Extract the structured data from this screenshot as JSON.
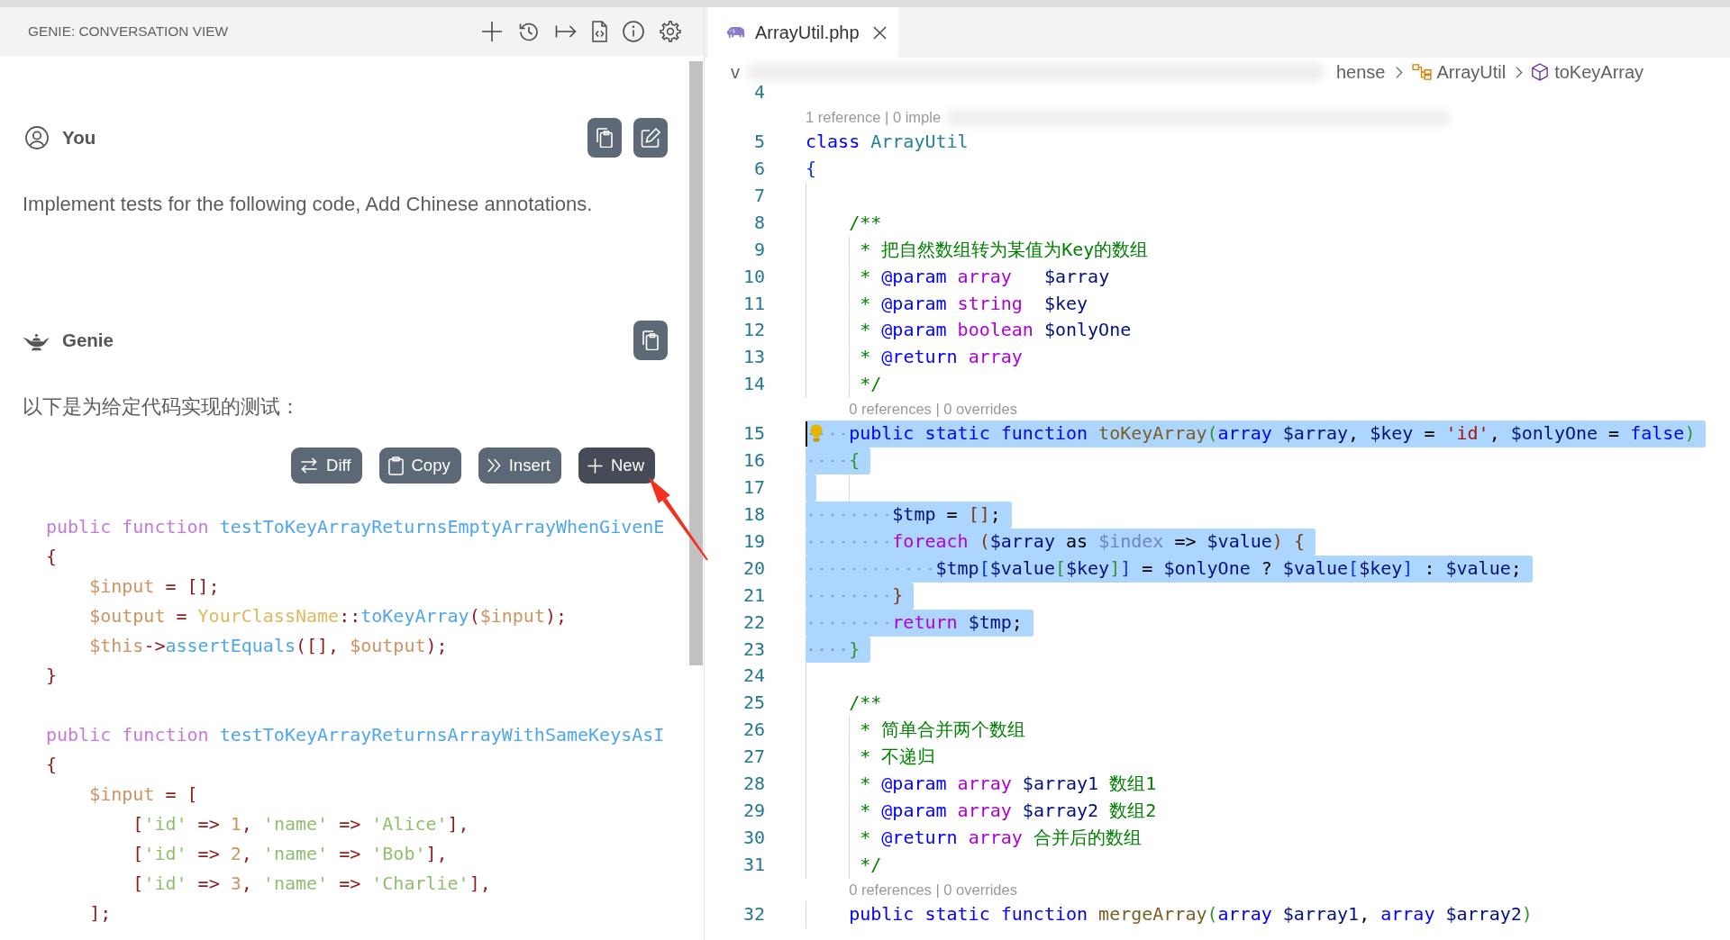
{
  "chat": {
    "title": "GENIE: CONVERSATION VIEW",
    "messages": [
      {
        "kind": "user",
        "author": "You",
        "text": "Implement tests for the following code, Add Chinese annotations."
      },
      {
        "kind": "assistant",
        "author": "Genie",
        "text": "以下是为给定代码实现的测试：",
        "code_actions": [
          {
            "label": "Diff",
            "kind": "diff",
            "hovered": false
          },
          {
            "label": "Copy",
            "kind": "copy",
            "hovered": false
          },
          {
            "label": "Insert",
            "kind": "insert",
            "hovered": false
          },
          {
            "label": "New",
            "kind": "new",
            "hovered": true
          }
        ],
        "code_lines": [
          {
            "kind": "code",
            "tokens": [
              {
                "text": "public function ",
                "kind": "keyword"
              },
              {
                "text": "testToKeyArrayReturnsEmptyArrayWhenGivenE",
                "kind": "function"
              }
            ]
          },
          {
            "kind": "code",
            "tokens": [
              {
                "text": "{",
                "kind": "punct"
              }
            ]
          },
          {
            "kind": "code",
            "tokens": [
              {
                "text": "    $input",
                "kind": "variable"
              },
              {
                "text": " = [];",
                "kind": "punct"
              }
            ]
          },
          {
            "kind": "code",
            "tokens": [
              {
                "text": "    $output",
                "kind": "variable"
              },
              {
                "text": " = ",
                "kind": "punct"
              },
              {
                "text": "YourClassName",
                "kind": "class"
              },
              {
                "text": "::",
                "kind": "punct"
              },
              {
                "text": "toKeyArray",
                "kind": "function"
              },
              {
                "text": "(",
                "kind": "punct"
              },
              {
                "text": "$input",
                "kind": "variable"
              },
              {
                "text": ");",
                "kind": "punct"
              }
            ]
          },
          {
            "kind": "code",
            "tokens": [
              {
                "text": "    $this",
                "kind": "variable"
              },
              {
                "text": "->",
                "kind": "punct"
              },
              {
                "text": "assertEquals",
                "kind": "function"
              },
              {
                "text": "([], ",
                "kind": "punct"
              },
              {
                "text": "$output",
                "kind": "variable"
              },
              {
                "text": ");",
                "kind": "punct"
              }
            ]
          },
          {
            "kind": "code",
            "tokens": [
              {
                "text": "}",
                "kind": "punct"
              }
            ]
          },
          {
            "kind": "blank"
          },
          {
            "kind": "code",
            "tokens": [
              {
                "text": "public function ",
                "kind": "keyword"
              },
              {
                "text": "testToKeyArrayReturnsArrayWithSameKeysAsI",
                "kind": "function"
              }
            ]
          },
          {
            "kind": "code",
            "tokens": [
              {
                "text": "{",
                "kind": "punct"
              }
            ]
          },
          {
            "kind": "code",
            "tokens": [
              {
                "text": "    $input",
                "kind": "variable"
              },
              {
                "text": " = [",
                "kind": "punct"
              }
            ]
          },
          {
            "kind": "code",
            "tokens": [
              {
                "text": "        [",
                "kind": "punct"
              },
              {
                "text": "'id'",
                "kind": "string"
              },
              {
                "text": " => ",
                "kind": "punct"
              },
              {
                "text": "1",
                "kind": "number"
              },
              {
                "text": ", ",
                "kind": "punct"
              },
              {
                "text": "'name'",
                "kind": "string"
              },
              {
                "text": " => ",
                "kind": "punct"
              },
              {
                "text": "'Alice'",
                "kind": "string"
              },
              {
                "text": "],",
                "kind": "punct"
              }
            ]
          },
          {
            "kind": "code",
            "tokens": [
              {
                "text": "        [",
                "kind": "punct"
              },
              {
                "text": "'id'",
                "kind": "string"
              },
              {
                "text": " => ",
                "kind": "punct"
              },
              {
                "text": "2",
                "kind": "number"
              },
              {
                "text": ", ",
                "kind": "punct"
              },
              {
                "text": "'name'",
                "kind": "string"
              },
              {
                "text": " => ",
                "kind": "punct"
              },
              {
                "text": "'Bob'",
                "kind": "string"
              },
              {
                "text": "],",
                "kind": "punct"
              }
            ]
          },
          {
            "kind": "code",
            "tokens": [
              {
                "text": "        [",
                "kind": "punct"
              },
              {
                "text": "'id'",
                "kind": "string"
              },
              {
                "text": " => ",
                "kind": "punct"
              },
              {
                "text": "3",
                "kind": "number"
              },
              {
                "text": ", ",
                "kind": "punct"
              },
              {
                "text": "'name'",
                "kind": "string"
              },
              {
                "text": " => ",
                "kind": "punct"
              },
              {
                "text": "'Charlie'",
                "kind": "string"
              },
              {
                "text": "],",
                "kind": "punct"
              }
            ]
          },
          {
            "kind": "code",
            "tokens": [
              {
                "text": "    ];",
                "kind": "punct"
              }
            ]
          }
        ]
      }
    ]
  },
  "editor": {
    "tabs": [
      {
        "label": "ArrayUtil.php",
        "selected": true
      }
    ],
    "breadcrumbs": [
      {
        "label": "v",
        "kind": "folder",
        "blurred_before": false
      },
      {
        "label": "hense",
        "kind": "folder",
        "blurred_before": true
      },
      {
        "label": "ArrayUtil",
        "kind": "class",
        "blurred_before": false
      },
      {
        "label": "toKeyArray",
        "kind": "method",
        "blurred_before": false
      }
    ],
    "lines": [
      {
        "kind": "code",
        "number": "4",
        "selected": false,
        "cursor": false,
        "lightbulb": false
      },
      {
        "kind": "codelens",
        "text": "1 reference | 0 imple",
        "blurred_after": true
      },
      {
        "kind": "code",
        "number": "5",
        "selected": false,
        "cursor": false,
        "lightbulb": false,
        "tokens": [
          {
            "text": "class ",
            "kind": "keyword"
          },
          {
            "text": "ArrayUtil",
            "kind": "class"
          }
        ]
      },
      {
        "kind": "code",
        "number": "6",
        "selected": false,
        "cursor": false,
        "lightbulb": false,
        "tokens": [
          {
            "text": "{",
            "kind": "bracket1"
          }
        ]
      },
      {
        "kind": "code",
        "number": "7",
        "selected": false,
        "cursor": false,
        "lightbulb": false
      },
      {
        "kind": "code",
        "number": "8",
        "selected": false,
        "cursor": false,
        "lightbulb": false,
        "tokens": [
          {
            "text": "    /**",
            "kind": "comment"
          }
        ]
      },
      {
        "kind": "code",
        "number": "9",
        "selected": false,
        "cursor": false,
        "lightbulb": false,
        "tokens": [
          {
            "text": "     * 把自然数组转为某值为Key的数组",
            "kind": "comment"
          }
        ]
      },
      {
        "kind": "code",
        "number": "10",
        "selected": false,
        "cursor": false,
        "lightbulb": false,
        "tokens": [
          {
            "text": "     * ",
            "kind": "comment"
          },
          {
            "text": "@param",
            "kind": "doc_tag"
          },
          {
            "text": " array",
            "kind": "doc_type"
          },
          {
            "text": "   $array",
            "kind": "variable"
          }
        ]
      },
      {
        "kind": "code",
        "number": "11",
        "selected": false,
        "cursor": false,
        "lightbulb": false,
        "tokens": [
          {
            "text": "     * ",
            "kind": "comment"
          },
          {
            "text": "@param",
            "kind": "doc_tag"
          },
          {
            "text": " string",
            "kind": "doc_type"
          },
          {
            "text": "  $key",
            "kind": "variable"
          }
        ]
      },
      {
        "kind": "code",
        "number": "12",
        "selected": false,
        "cursor": false,
        "lightbulb": false,
        "tokens": [
          {
            "text": "     * ",
            "kind": "comment"
          },
          {
            "text": "@param",
            "kind": "doc_tag"
          },
          {
            "text": " boolean",
            "kind": "doc_type"
          },
          {
            "text": " $onlyOne",
            "kind": "variable"
          }
        ]
      },
      {
        "kind": "code",
        "number": "13",
        "selected": false,
        "cursor": false,
        "lightbulb": false,
        "tokens": [
          {
            "text": "     * ",
            "kind": "comment"
          },
          {
            "text": "@return",
            "kind": "doc_tag"
          },
          {
            "text": " array",
            "kind": "doc_type"
          }
        ]
      },
      {
        "kind": "code",
        "number": "14",
        "selected": false,
        "cursor": false,
        "lightbulb": false,
        "tokens": [
          {
            "text": "     */",
            "kind": "comment"
          }
        ]
      },
      {
        "kind": "codelens",
        "text": "0 references | 0 overrides",
        "blurred_after": false
      },
      {
        "kind": "code",
        "number": "15",
        "selected": true,
        "cursor": true,
        "lightbulb": true,
        "tokens": [
          {
            "text": "    public static function ",
            "kind": "keyword"
          },
          {
            "text": "toKeyArray",
            "kind": "function"
          },
          {
            "text": "(",
            "kind": "bracket2"
          },
          {
            "text": "array ",
            "kind": "keyword"
          },
          {
            "text": "$array",
            "kind": "variable"
          },
          {
            "text": ", ",
            "kind": "plain"
          },
          {
            "text": "$key",
            "kind": "variable"
          },
          {
            "text": " = ",
            "kind": "plain"
          },
          {
            "text": "'id'",
            "kind": "string"
          },
          {
            "text": ", ",
            "kind": "plain"
          },
          {
            "text": "$onlyOne",
            "kind": "variable"
          },
          {
            "text": " = ",
            "kind": "plain"
          },
          {
            "text": "false",
            "kind": "keyword"
          },
          {
            "text": ")",
            "kind": "bracket2"
          }
        ]
      },
      {
        "kind": "code",
        "number": "16",
        "selected": true,
        "cursor": false,
        "lightbulb": false,
        "tokens": [
          {
            "text": "    {",
            "kind": "bracket2"
          }
        ]
      },
      {
        "kind": "code",
        "number": "17",
        "selected": true,
        "cursor": false,
        "lightbulb": false
      },
      {
        "kind": "code",
        "number": "18",
        "selected": true,
        "cursor": false,
        "lightbulb": false,
        "tokens": [
          {
            "text": "        $tmp",
            "kind": "variable"
          },
          {
            "text": " = ",
            "kind": "plain"
          },
          {
            "text": "[]",
            "kind": "bracket3"
          },
          {
            "text": ";",
            "kind": "plain"
          }
        ]
      },
      {
        "kind": "code",
        "number": "19",
        "selected": true,
        "cursor": false,
        "lightbulb": false,
        "tokens": [
          {
            "text": "        foreach ",
            "kind": "control"
          },
          {
            "text": "(",
            "kind": "bracket3"
          },
          {
            "text": "$array ",
            "kind": "variable"
          },
          {
            "text": "as ",
            "kind": "plain"
          },
          {
            "text": "$index ",
            "kind": "unused"
          },
          {
            "text": "=> ",
            "kind": "plain"
          },
          {
            "text": "$value",
            "kind": "variable"
          },
          {
            "text": ") {",
            "kind": "bracket3"
          }
        ]
      },
      {
        "kind": "code",
        "number": "20",
        "selected": true,
        "cursor": false,
        "lightbulb": false,
        "tokens": [
          {
            "text": "            $tmp",
            "kind": "variable"
          },
          {
            "text": "[",
            "kind": "bracket1"
          },
          {
            "text": "$value",
            "kind": "variable"
          },
          {
            "text": "[",
            "kind": "bracket2"
          },
          {
            "text": "$key",
            "kind": "variable"
          },
          {
            "text": "]",
            "kind": "bracket2"
          },
          {
            "text": "]",
            "kind": "bracket1"
          },
          {
            "text": " = ",
            "kind": "plain"
          },
          {
            "text": "$onlyOne",
            "kind": "variable"
          },
          {
            "text": " ? ",
            "kind": "plain"
          },
          {
            "text": "$value",
            "kind": "variable"
          },
          {
            "text": "[",
            "kind": "bracket1"
          },
          {
            "text": "$key",
            "kind": "variable"
          },
          {
            "text": "]",
            "kind": "bracket1"
          },
          {
            "text": " : ",
            "kind": "plain"
          },
          {
            "text": "$value",
            "kind": "variable"
          },
          {
            "text": ";",
            "kind": "plain"
          }
        ]
      },
      {
        "kind": "code",
        "number": "21",
        "selected": true,
        "cursor": false,
        "lightbulb": false,
        "tokens": [
          {
            "text": "        }",
            "kind": "bracket3"
          }
        ]
      },
      {
        "kind": "code",
        "number": "22",
        "selected": true,
        "cursor": false,
        "lightbulb": false,
        "tokens": [
          {
            "text": "        return ",
            "kind": "control"
          },
          {
            "text": "$tmp",
            "kind": "variable"
          },
          {
            "text": ";",
            "kind": "plain"
          }
        ]
      },
      {
        "kind": "code",
        "number": "23",
        "selected": true,
        "cursor": false,
        "lightbulb": false,
        "tokens": [
          {
            "text": "    }",
            "kind": "bracket2"
          }
        ]
      },
      {
        "kind": "code",
        "number": "24",
        "selected": false,
        "cursor": false,
        "lightbulb": false
      },
      {
        "kind": "code",
        "number": "25",
        "selected": false,
        "cursor": false,
        "lightbulb": false,
        "tokens": [
          {
            "text": "    /**",
            "kind": "comment"
          }
        ]
      },
      {
        "kind": "code",
        "number": "26",
        "selected": false,
        "cursor": false,
        "lightbulb": false,
        "tokens": [
          {
            "text": "     * 简单合并两个数组",
            "kind": "comment"
          }
        ]
      },
      {
        "kind": "code",
        "number": "27",
        "selected": false,
        "cursor": false,
        "lightbulb": false,
        "tokens": [
          {
            "text": "     * 不递归",
            "kind": "comment"
          }
        ]
      },
      {
        "kind": "code",
        "number": "28",
        "selected": false,
        "cursor": false,
        "lightbulb": false,
        "tokens": [
          {
            "text": "     * ",
            "kind": "comment"
          },
          {
            "text": "@param",
            "kind": "doc_tag"
          },
          {
            "text": " array",
            "kind": "doc_type"
          },
          {
            "text": " $array1",
            "kind": "variable"
          },
          {
            "text": " 数组1",
            "kind": "comment"
          }
        ]
      },
      {
        "kind": "code",
        "number": "29",
        "selected": false,
        "cursor": false,
        "lightbulb": false,
        "tokens": [
          {
            "text": "     * ",
            "kind": "comment"
          },
          {
            "text": "@param",
            "kind": "doc_tag"
          },
          {
            "text": " array",
            "kind": "doc_type"
          },
          {
            "text": " $array2",
            "kind": "variable"
          },
          {
            "text": " 数组2",
            "kind": "comment"
          }
        ]
      },
      {
        "kind": "code",
        "number": "30",
        "selected": false,
        "cursor": false,
        "lightbulb": false,
        "tokens": [
          {
            "text": "     * ",
            "kind": "comment"
          },
          {
            "text": "@return",
            "kind": "doc_tag"
          },
          {
            "text": " array",
            "kind": "doc_type"
          },
          {
            "text": " 合并后的数组",
            "kind": "comment"
          }
        ]
      },
      {
        "kind": "code",
        "number": "31",
        "selected": false,
        "cursor": false,
        "lightbulb": false,
        "tokens": [
          {
            "text": "     */",
            "kind": "comment"
          }
        ]
      },
      {
        "kind": "codelens",
        "text": "0 references | 0 overrides",
        "blurred_after": false
      },
      {
        "kind": "code",
        "number": "32",
        "selected": false,
        "cursor": false,
        "lightbulb": false,
        "tokens": [
          {
            "text": "    public static function ",
            "kind": "keyword"
          },
          {
            "text": "mergeArray",
            "kind": "function"
          },
          {
            "text": "(",
            "kind": "bracket2"
          },
          {
            "text": "array ",
            "kind": "keyword"
          },
          {
            "text": "$array1",
            "kind": "variable"
          },
          {
            "text": ", ",
            "kind": "plain"
          },
          {
            "text": "array ",
            "kind": "keyword"
          },
          {
            "text": "$array2",
            "kind": "variable"
          },
          {
            "text": ")",
            "kind": "bracket2"
          }
        ]
      }
    ]
  }
}
